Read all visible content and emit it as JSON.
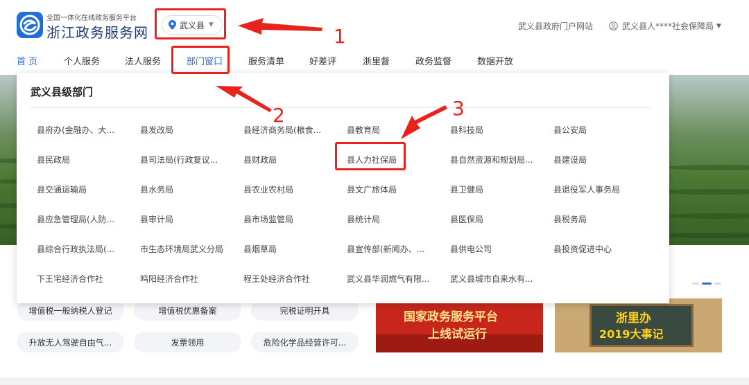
{
  "header": {
    "brand_sub": "全国一体化在线政务服务平台",
    "brand_title": "浙江政务服务网",
    "region": "武义县",
    "portal_link": "武义县政府门户网站",
    "user": "武义县人****社会保障局"
  },
  "nav": [
    "首 页",
    "个人服务",
    "法人服务",
    "部门窗口",
    "服务清单",
    "好差评",
    "浙里督",
    "政务监督",
    "数据开放"
  ],
  "dropdown": {
    "title": "武义县级部门",
    "rows": [
      [
        "县府办(金融办、大...",
        "县发改局",
        "县经济商务局(粮食...",
        "县教育局",
        "县科技局",
        "县公安局"
      ],
      [
        "县民政局",
        "县司法局(行政复议...",
        "县财政局",
        "县人力社保局",
        "县自然资源和规划局...",
        "县建设局"
      ],
      [
        "县交通运输局",
        "县水务局",
        "县农业农村局",
        "县文广旅体局",
        "县卫健局",
        "县退役军人事务局"
      ],
      [
        "县应急管理局(人防...",
        "县审计局",
        "县市场监管局",
        "县统计局",
        "县医保局",
        "县税务局"
      ],
      [
        "县综合行政执法局(...",
        "市生态环境局武义分局",
        "县烟草局",
        "县宣传部(新闻办、...",
        "县供电公司",
        "县投资促进中心"
      ],
      [
        "下王宅经济合作社",
        "鸣阳经济合作社",
        "程王处经济合作社",
        "武义县华润燃气有限...",
        "武义县城市自来水有..."
      ]
    ]
  },
  "services": {
    "row1": [
      "增值税一般纳税人登记",
      "增值税优惠备案",
      "完税证明开具"
    ],
    "row2": [
      "升放无人驾驶自由气...",
      "发票领用",
      "危险化学品经营许可..."
    ]
  },
  "cards": {
    "card1_line1": "国家政务服务平台",
    "card1_line2": "上线试运行",
    "card2_line1": "浙里办",
    "card2_line2": "2019大事记"
  },
  "annotations": [
    "1",
    "2",
    "3"
  ],
  "colors": {
    "accent": "#2a6fd6",
    "annotation": "#e8231d"
  }
}
